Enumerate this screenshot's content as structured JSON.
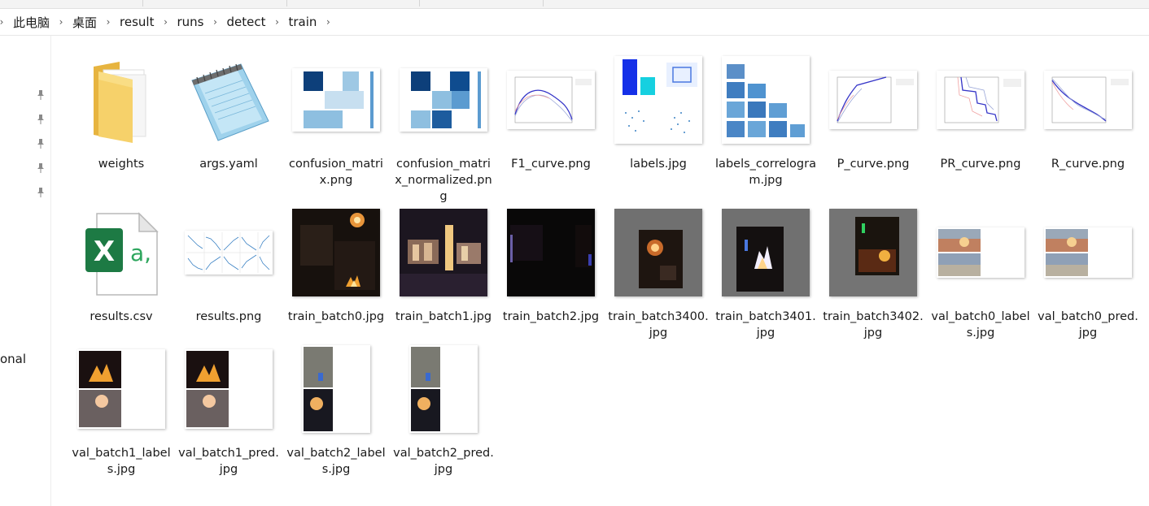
{
  "breadcrumb": {
    "items": [
      "此电脑",
      "桌面",
      "result",
      "runs",
      "detect",
      "train"
    ]
  },
  "left_pane": {
    "partial_label": "onal"
  },
  "files": [
    {
      "name": "weights",
      "kind": "folder"
    },
    {
      "name": "args.yaml",
      "kind": "notepad"
    },
    {
      "name": "confusion_matrix.png",
      "kind": "confusion"
    },
    {
      "name": "confusion_matrix_normalized.png",
      "kind": "confusion"
    },
    {
      "name": "F1_curve.png",
      "kind": "curve"
    },
    {
      "name": "labels.jpg",
      "kind": "labels"
    },
    {
      "name": "labels_correlogram.jpg",
      "kind": "correlogram"
    },
    {
      "name": "P_curve.png",
      "kind": "curve"
    },
    {
      "name": "PR_curve.png",
      "kind": "curve"
    },
    {
      "name": "R_curve.png",
      "kind": "curve"
    },
    {
      "name": "results.csv",
      "kind": "excel"
    },
    {
      "name": "results.png",
      "kind": "results"
    },
    {
      "name": "train_batch0.jpg",
      "kind": "photo"
    },
    {
      "name": "train_batch1.jpg",
      "kind": "photo"
    },
    {
      "name": "train_batch2.jpg",
      "kind": "photo"
    },
    {
      "name": "train_batch3400.jpg",
      "kind": "photo"
    },
    {
      "name": "train_batch3401.jpg",
      "kind": "photo"
    },
    {
      "name": "train_batch3402.jpg",
      "kind": "photo"
    },
    {
      "name": "val_batch0_labels.jpg",
      "kind": "val"
    },
    {
      "name": "val_batch0_pred.jpg",
      "kind": "val"
    },
    {
      "name": "val_batch1_labels.jpg",
      "kind": "val"
    },
    {
      "name": "val_batch1_pred.jpg",
      "kind": "val"
    },
    {
      "name": "val_batch2_labels.jpg",
      "kind": "val"
    },
    {
      "name": "val_batch2_pred.jpg",
      "kind": "val"
    }
  ],
  "icons": {
    "pin": "pin-icon",
    "chevron": "chevron-right-icon",
    "folder": "folder-icon",
    "notepad": "notepad-icon",
    "excel": "excel-icon",
    "excel_letters": "X a,"
  },
  "colors": {
    "excel_green": "#1d7a44",
    "folder_yellow": "#f3c54d",
    "notepad_blue": "#7cc0e4",
    "matrix_navy": "#0d3f7a"
  }
}
